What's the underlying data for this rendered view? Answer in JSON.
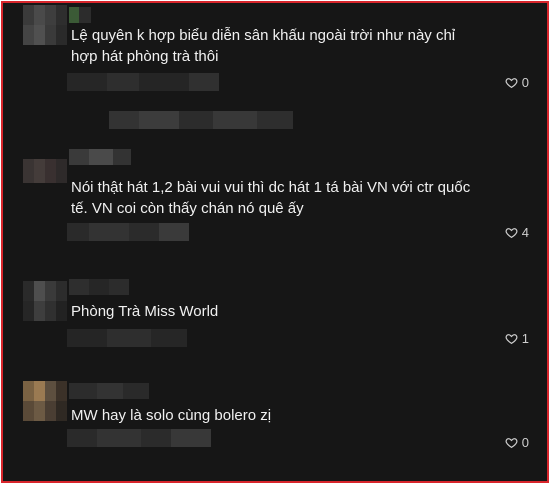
{
  "comments": [
    {
      "text": "Lệ quyên k hợp biểu diễn sân khấu ngoài trời như này chỉ hợp hát phòng trà thôi",
      "likes": "0"
    },
    {
      "text": "Nói thật hát 1,2 bài vui vui thì dc hát 1 tá bài VN với ctr quốc tế. VN coi còn thấy chán nó quê ấy",
      "likes": "4"
    },
    {
      "text": "Phòng Trà Miss World",
      "likes": "1"
    },
    {
      "text": "MW hay là solo cùng bolero zị",
      "likes": "0"
    }
  ],
  "icons": {
    "like": "heart-outline-icon"
  },
  "colors": {
    "background": "#161616",
    "border": "#d8262c",
    "text": "#f1f1f1"
  }
}
